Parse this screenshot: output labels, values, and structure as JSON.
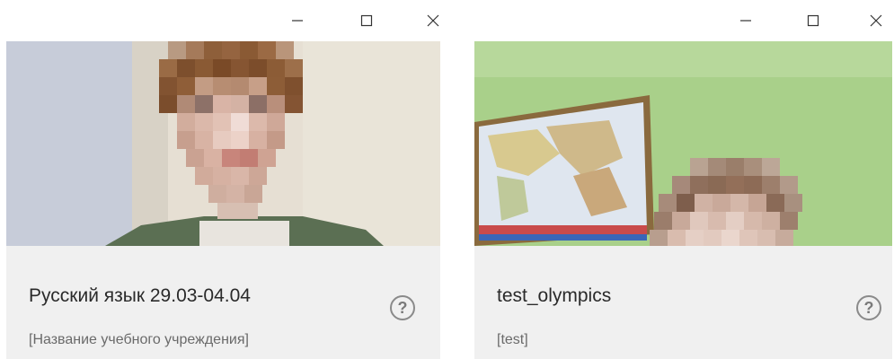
{
  "windows": [
    {
      "title": "Русский язык 29.03-04.04",
      "subtitle": "[Название учебного учреждения]",
      "help_glyph": "?",
      "controls": [
        "minimize-icon",
        "maximize-icon",
        "close-icon"
      ]
    },
    {
      "title": "test_olympics",
      "subtitle": "[test]",
      "help_glyph": "?",
      "controls": [
        "minimize-icon",
        "maximize-icon",
        "close-icon"
      ]
    }
  ],
  "colors": {
    "info_panel": "#f0f0f0",
    "title_text": "#2a2a2a",
    "subtitle_text": "#6a6a6a",
    "left_wall": "#e4ddcf",
    "right_wall": "#a9d08a",
    "hair": "#8a5a34",
    "skin": "#d9b4a6"
  }
}
